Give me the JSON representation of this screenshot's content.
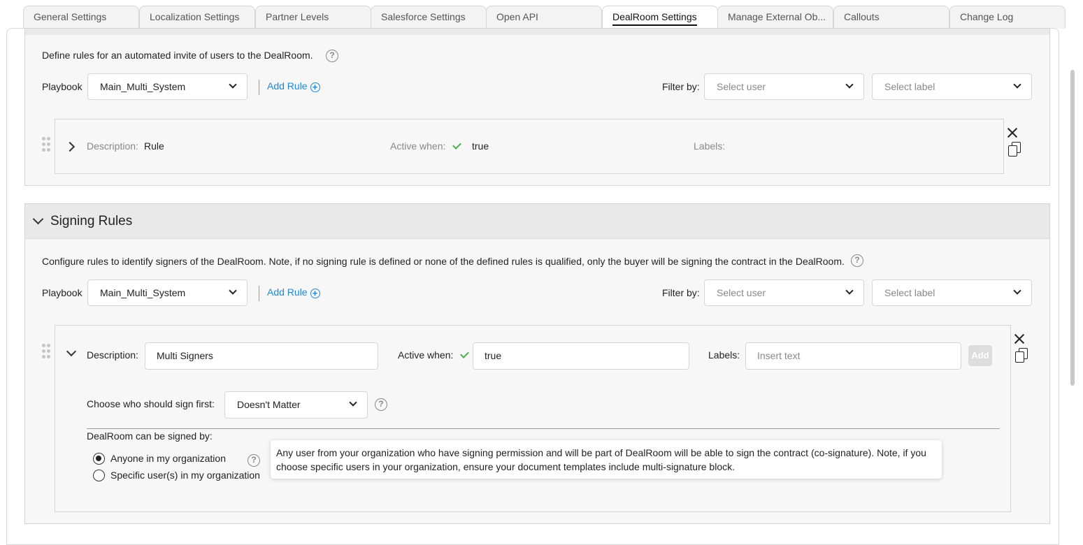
{
  "tabs": [
    {
      "label": "General Settings",
      "active": false
    },
    {
      "label": "Localization Settings",
      "active": false
    },
    {
      "label": "Partner Levels",
      "active": false
    },
    {
      "label": "Salesforce Settings",
      "active": false
    },
    {
      "label": "Open API",
      "active": false
    },
    {
      "label": "DealRoom Settings",
      "active": true
    },
    {
      "label": "Manage External Ob...",
      "active": false
    },
    {
      "label": "Callouts",
      "active": false
    },
    {
      "label": "Change Log",
      "active": false
    }
  ],
  "invite": {
    "description": "Define rules for an automated invite of users to the DealRoom.",
    "playbook_label": "Playbook",
    "playbook_value": "Main_Multi_System",
    "add_rule_label": "Add Rule",
    "filter_label": "Filter by:",
    "user_placeholder": "Select user",
    "label_placeholder": "Select label",
    "rule": {
      "description_label": "Description:",
      "description_value": "Rule",
      "active_label": "Active when:",
      "active_value": "true",
      "labels_label": "Labels:"
    }
  },
  "signing": {
    "title": "Signing Rules",
    "description": "Configure rules to identify signers of the DealRoom. Note, if no signing rule is defined or none of the defined rules is qualified, only the buyer will be signing the contract in the DealRoom.",
    "playbook_label": "Playbook",
    "playbook_value": "Main_Multi_System",
    "add_rule_label": "Add Rule",
    "filter_label": "Filter by:",
    "user_placeholder": "Select user",
    "label_placeholder": "Select label",
    "rule": {
      "description_label": "Description:",
      "description_value": "Multi Signers",
      "active_label": "Active when:",
      "active_value": "true",
      "labels_label": "Labels:",
      "labels_placeholder": "Insert text",
      "add_label": "Add",
      "sign_first_label": "Choose who should sign first:",
      "sign_first_value": "Doesn't Matter",
      "signed_by_label": "DealRoom can be signed by:",
      "options": [
        {
          "label": "Anyone in my organization",
          "selected": true
        },
        {
          "label": "Specific user(s) in my organization",
          "selected": false
        }
      ],
      "tooltip": "Any user from your organization who have signing permission and will be part of DealRoom will be able to sign the contract (co-signature). Note, if you choose specific users in your organization, ensure your document templates include multi-signature block."
    }
  },
  "colors": {
    "accent": "#1e88d8",
    "check": "#4caf50",
    "panel_bg": "#f7f7f7",
    "header_bg": "#e9e9e9"
  }
}
